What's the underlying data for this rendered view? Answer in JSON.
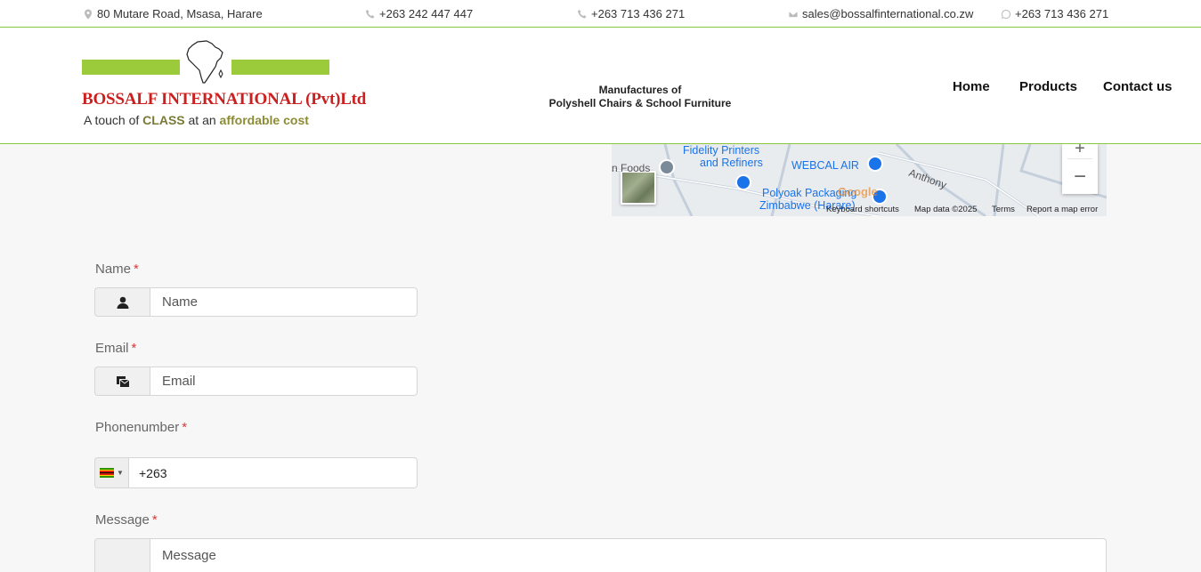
{
  "topbar": {
    "address": "80 Mutare Road, Msasa, Harare",
    "phone1": "+263 242 447 447",
    "phone2": "+263 713 436 271",
    "email": "sales@bossalfinternational.co.zw",
    "whatsapp": "+263 713 436 271",
    "icons": [
      "map-marker-icon",
      "phone-icon",
      "phone-icon",
      "envelope-icon",
      "whatsapp-icon"
    ]
  },
  "header": {
    "logo_name": "BOSSALF INTERNATIONAL (Pvt)Ltd",
    "logo_tag_prefix": "A touch of ",
    "logo_tag_class": "CLASS",
    "logo_tag_mid": " at an ",
    "logo_tag_affordable": "affordable cost",
    "tagline_line1": "Manufactures of",
    "tagline_line2": "Polyshell Chairs & School Furniture",
    "nav": [
      "Home",
      "Products",
      "Contact us"
    ]
  },
  "map": {
    "places": [
      "Fidelity Printers",
      "and Refiners",
      "WEBCAL AIR",
      "Polyoak Packaging",
      "Zimbabwe (Harare)",
      "Anthony",
      "n Foods"
    ],
    "logo": "Google",
    "zoom_in": "+",
    "zoom_out": "−",
    "attribution": [
      "Keyboard shortcuts",
      "Map data ©2025",
      "Terms",
      "Report a map error"
    ]
  },
  "form": {
    "name_label": "Name",
    "name_placeholder": "Name",
    "email_label": "Email",
    "email_placeholder": "Email",
    "phone_label": "Phonenumber",
    "phone_value": "+263",
    "message_label": "Message",
    "message_placeholder": "Message",
    "required_mark": "*"
  },
  "colors": {
    "accent_green": "#8cc63f",
    "logo_red": "#cc1f1f",
    "required_red": "#d9383a"
  }
}
